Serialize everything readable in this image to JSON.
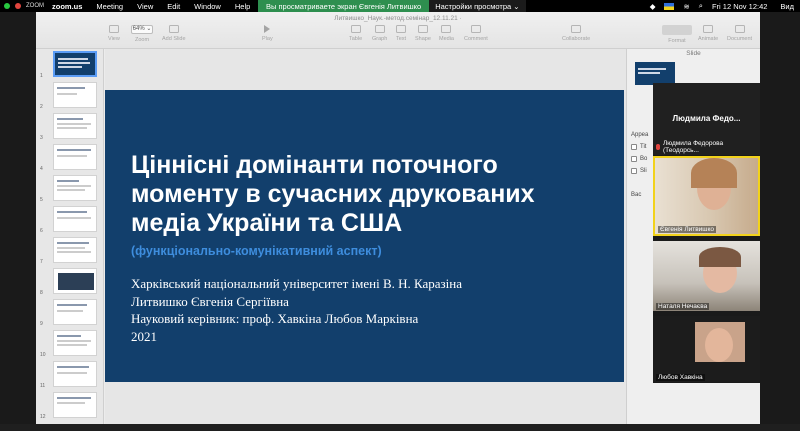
{
  "zoom_bar": {
    "app_label": "ZOOM",
    "sharing_text": "Вы просматриваете экран Євгенія Литвишко",
    "view_options_label": "Настройки просмотра ⌄",
    "view_label": "Вид"
  },
  "menu_bar": {
    "app_name": "zoom.us",
    "menus": [
      "zoom.us",
      "Meeting",
      "View",
      "Edit",
      "Window",
      "Help"
    ],
    "datetime": "Fri 12 Nov  12:42"
  },
  "keynote": {
    "document_title": "Литвишко_Наук.-метод.семінар_12.11.21 ·",
    "toolbar": {
      "view": "View",
      "zoom": "Zoom",
      "zoom_value": "64% ⌄",
      "add_slide": "Add Slide",
      "play": "Play",
      "table": "Table",
      "graph": "Graph",
      "text": "Text",
      "shape": "Shape",
      "media": "Media",
      "comment": "Comment",
      "collaborate": "Collaborate",
      "format": "Format",
      "animate": "Animate",
      "document": "Document"
    },
    "slide_numbers": [
      "1",
      "2",
      "3",
      "4",
      "5",
      "6",
      "7",
      "8",
      "9",
      "10",
      "11",
      "12"
    ],
    "inspector": {
      "heading": "Slide",
      "appearance": "Appea",
      "title_opt": "Tit",
      "body_opt": "Bo",
      "slide_number_opt": "Sli",
      "background": "Bac"
    }
  },
  "slide": {
    "title_lines": [
      "Ціннісні домінанти поточного",
      "моменту в сучасних друкованих",
      "медіа України та США"
    ],
    "subtitle": "(функціонально-комунікативний аспект)",
    "body_lines": [
      "Харківський національний університет імені В. Н. Каразіна",
      "Литвишко Євгенія Сергіївна",
      "Науковий керівник: проф. Хавкіна Любов Марківна",
      "2021"
    ]
  },
  "participants": [
    {
      "display": "Людмила  Федо...",
      "name": "Людмила Федорова (Теодорсь..."
    },
    {
      "name": "Євгенія Литвишко"
    },
    {
      "name": "Наталя Нечаєва"
    },
    {
      "name": "Любов Хавкіна"
    }
  ]
}
